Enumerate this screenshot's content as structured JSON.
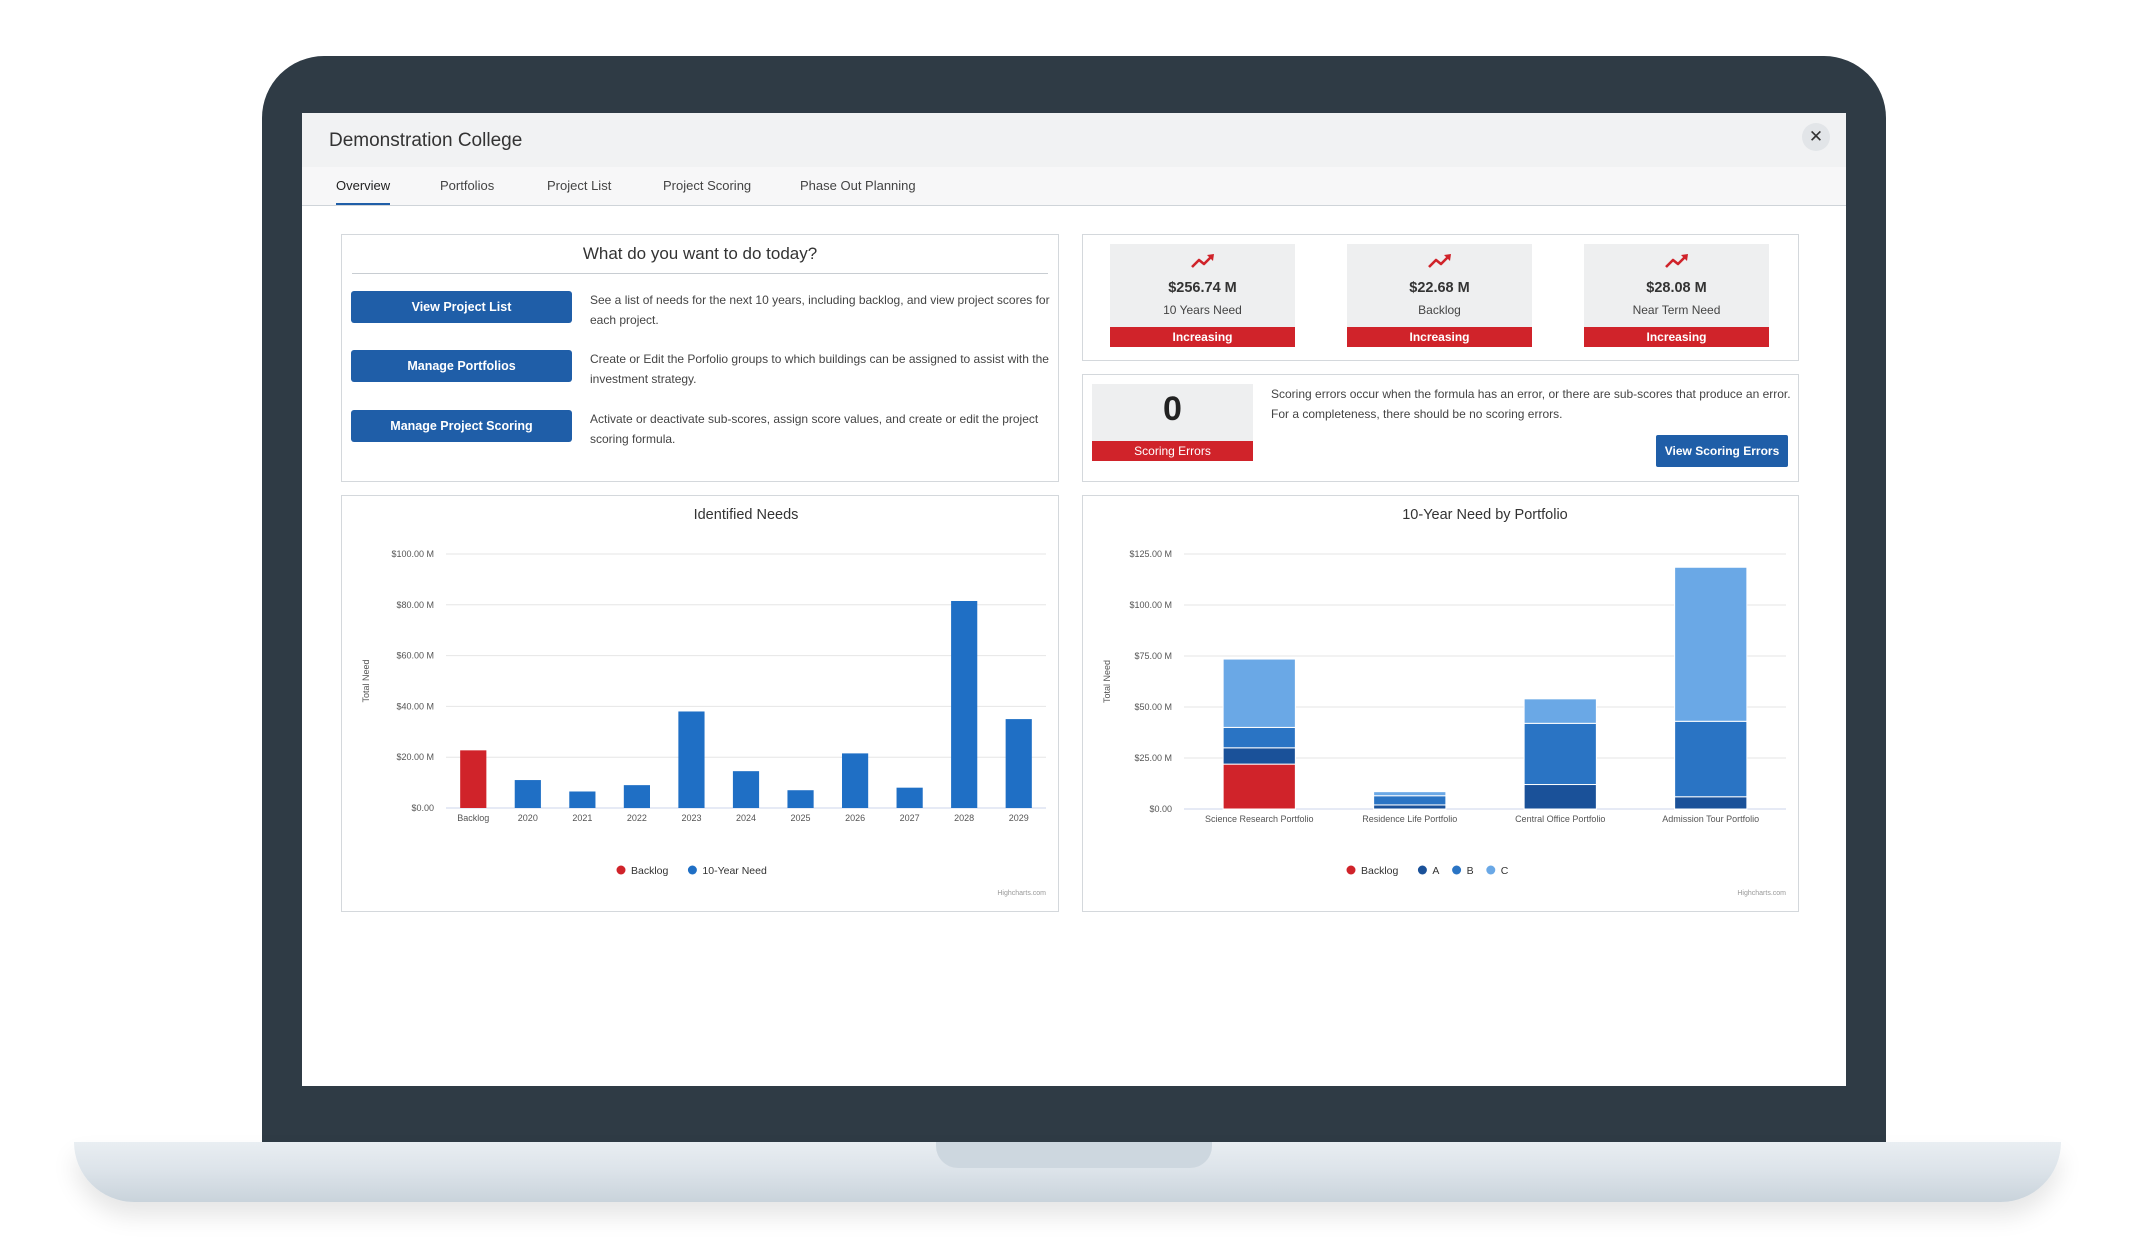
{
  "window": {
    "title": "Demonstration College",
    "close_label": "✕"
  },
  "tabs": [
    {
      "label": "Overview",
      "active": true
    },
    {
      "label": "Portfolios"
    },
    {
      "label": "Project List"
    },
    {
      "label": "Project Scoring"
    },
    {
      "label": "Phase Out Planning"
    }
  ],
  "todo": {
    "title": "What do you want to do today?",
    "actions": [
      {
        "button": "View Project List",
        "description": "See a list of needs for the next 10 years, including backlog, and view project scores for each project."
      },
      {
        "button": "Manage Portfolios",
        "description": "Create or Edit the Porfolio groups to which buildings can be assigned to assist with the investment strategy."
      },
      {
        "button": "Manage Project Scoring",
        "description": "Activate or deactivate sub-scores, assign score values, and create or edit the project scoring formula."
      }
    ]
  },
  "kpis": [
    {
      "value": "$256.74 M",
      "label": "10 Years Need",
      "trend": "Increasing",
      "icon": "trend-up-icon"
    },
    {
      "value": "$22.68 M",
      "label": "Backlog",
      "trend": "Increasing",
      "icon": "trend-up-icon"
    },
    {
      "value": "$28.08 M",
      "label": "Near Term Need",
      "trend": "Increasing",
      "icon": "trend-up-icon"
    }
  ],
  "scoring": {
    "value": "0",
    "label": "Scoring Errors",
    "description": "Scoring errors occur when the formula has an error, or there are sub-scores that produce an error. For a completeness, there should be no scoring errors.",
    "button": "View Scoring Errors"
  },
  "colors": {
    "accent": "#1f5ea8",
    "alert": "#d0232a",
    "backlog": "#d0232a",
    "need": "#1f6fc5",
    "a": "#1a5199",
    "b": "#2a74c4",
    "c": "#6aa8e6"
  },
  "chart_data": [
    {
      "type": "bar",
      "title": "Identified Needs",
      "ylabel": "Total Need",
      "xlabel": "",
      "ylim": [
        0,
        100
      ],
      "yticks": [
        "$0.00",
        "$20.00 M",
        "$40.00 M",
        "$60.00 M",
        "$80.00 M",
        "$100.00 M"
      ],
      "categories": [
        "Backlog",
        "2020",
        "2021",
        "2022",
        "2023",
        "2024",
        "2025",
        "2026",
        "2027",
        "2028",
        "2029"
      ],
      "series": [
        {
          "name": "Backlog",
          "values": [
            22.7,
            null,
            null,
            null,
            null,
            null,
            null,
            null,
            null,
            null,
            null
          ]
        },
        {
          "name": "10-Year Need",
          "values": [
            null,
            11,
            6.5,
            9,
            38,
            14.5,
            7,
            21.5,
            8,
            81.5,
            35
          ]
        }
      ],
      "legend": "bottom",
      "credit": "Highcharts.com"
    },
    {
      "type": "bar",
      "stacked": true,
      "title": "10-Year Need by Portfolio",
      "ylabel": "Total Need",
      "xlabel": "",
      "ylim": [
        0,
        125
      ],
      "yticks": [
        "$0.00",
        "$25.00 M",
        "$50.00 M",
        "$75.00 M",
        "$100.00 M",
        "$125.00 M"
      ],
      "categories": [
        "Science Research Portfolio",
        "Residence Life Portfolio",
        "Central Office Portfolio",
        "Admission Tour Portfolio"
      ],
      "series": [
        {
          "name": "Backlog",
          "values": [
            22,
            0,
            0,
            0
          ]
        },
        {
          "name": "A",
          "values": [
            8,
            2,
            12,
            6
          ]
        },
        {
          "name": "B",
          "values": [
            10,
            4.5,
            30,
            37
          ]
        },
        {
          "name": "C",
          "values": [
            33.5,
            2,
            12,
            75.5
          ]
        }
      ],
      "legend": "bottom",
      "credit": "Highcharts.com"
    }
  ]
}
